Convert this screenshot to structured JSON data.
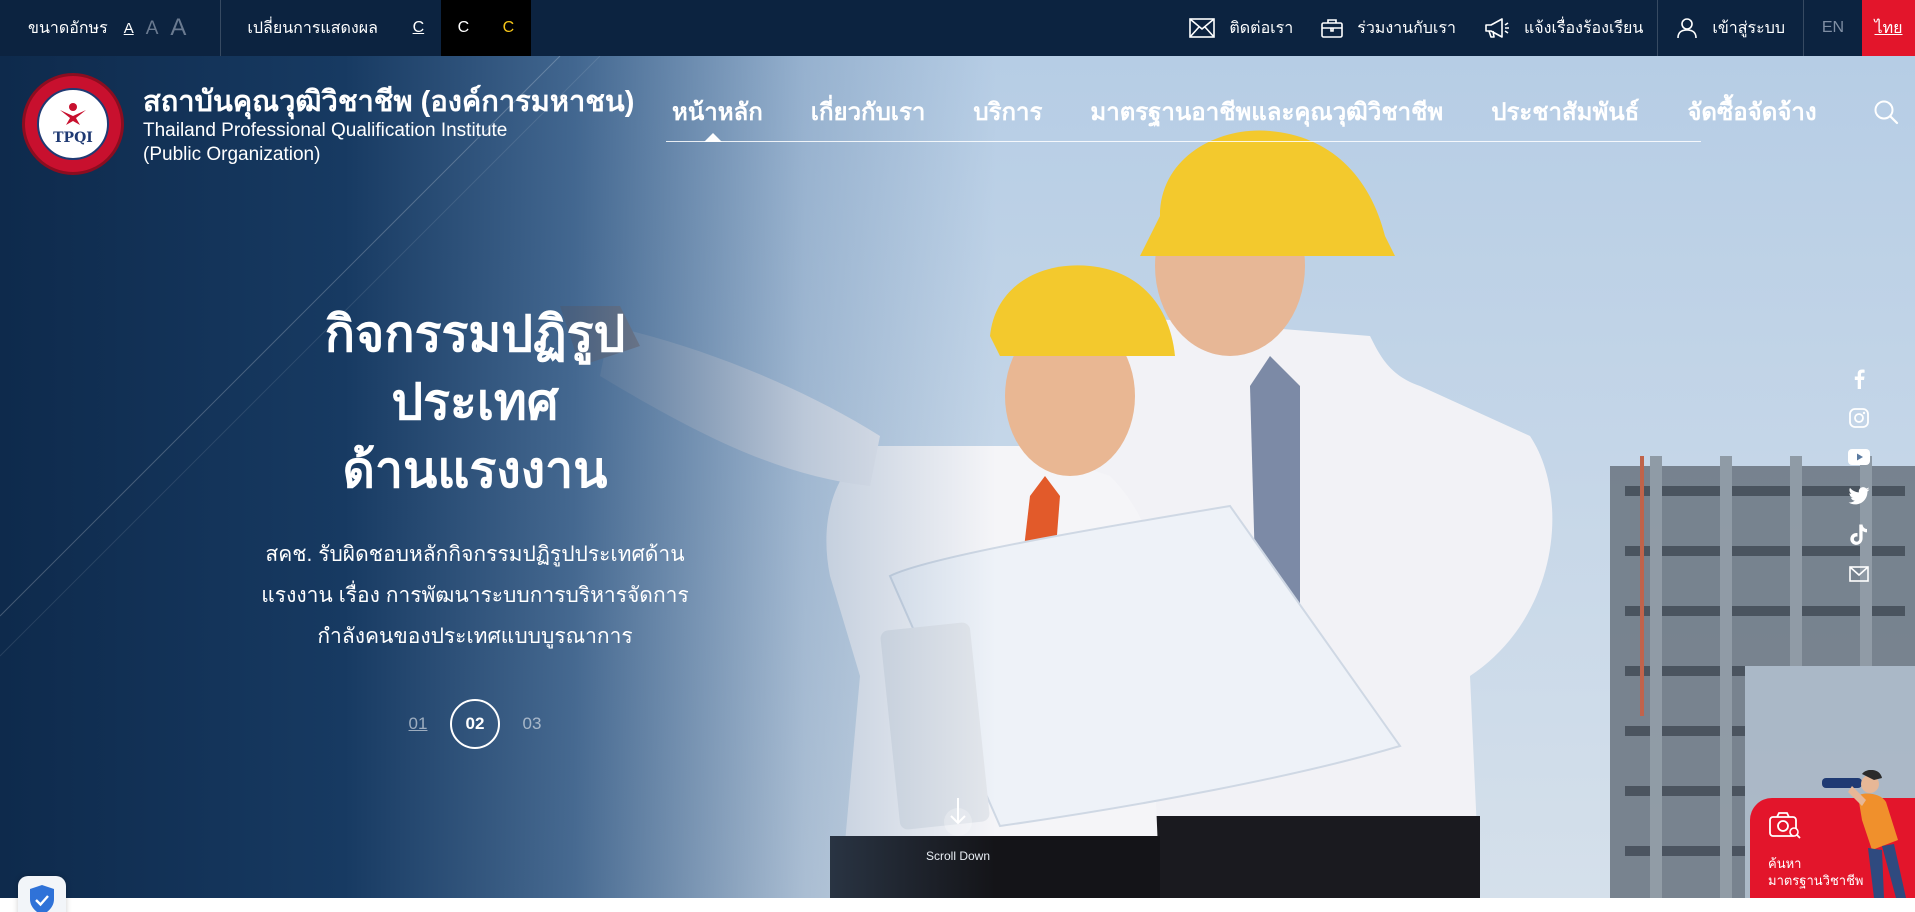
{
  "topbar": {
    "font_size_label": "ขนาดอักษร",
    "font_sizes": [
      "A",
      "A",
      "A"
    ],
    "contrast_label": "เปลี่ยนการแสดงผล",
    "contrast_options": [
      "C",
      "C",
      "C"
    ],
    "links": {
      "contact": "ติดต่อเรา",
      "careers": "ร่วมงานกับเรา",
      "complaint": "แจ้งเรื่องร้องเรียน",
      "login": "เข้าสู่ระบบ"
    },
    "languages": {
      "en": "EN",
      "th": "ไทย"
    }
  },
  "header": {
    "org_name_th": "สถาบันคุณวุฒิวิชาชีพ (องค์การมหาชน)",
    "org_name_en_line1": "Thailand Professional Qualification Institute",
    "org_name_en_line2": "(Public Organization)",
    "logo_text": "TPQI"
  },
  "nav": {
    "items": [
      "หน้าหลัก",
      "เกี่ยวกับเรา",
      "บริการ",
      "มาตรฐานอาชีพและคุณวุฒิวิชาชีพ",
      "ประชาสัมพันธ์",
      "จัดซื้อจัดจ้าง"
    ],
    "active_index": 0
  },
  "hero": {
    "title_line1": "กิจกรรมปฏิรูป",
    "title_line2": "ประเทศ",
    "title_line3": "ด้านแรงงาน",
    "desc_line1": "สคช. รับผิดชอบหลักกิจกรรมปฏิรูปประเทศด้าน",
    "desc_line2": "แรงงาน เรื่อง การพัฒนาระบบการบริหารจัดการ",
    "desc_line3": "กำลังคนของประเทศแบบบูรณาการ",
    "slides": [
      "01",
      "02",
      "03"
    ],
    "active_slide": 1,
    "scroll_label": "Scroll Down"
  },
  "social": [
    "facebook-icon",
    "instagram-icon",
    "youtube-icon",
    "twitter-icon",
    "tiktok-icon",
    "mail-icon"
  ],
  "widget": {
    "line1": "ค้นหา",
    "line2": "มาตรฐานวิชาชีพ"
  },
  "colors": {
    "topbar_bg": "#0c2340",
    "accent_red": "#e3152b",
    "contrast_yellow": "#f5c518"
  }
}
